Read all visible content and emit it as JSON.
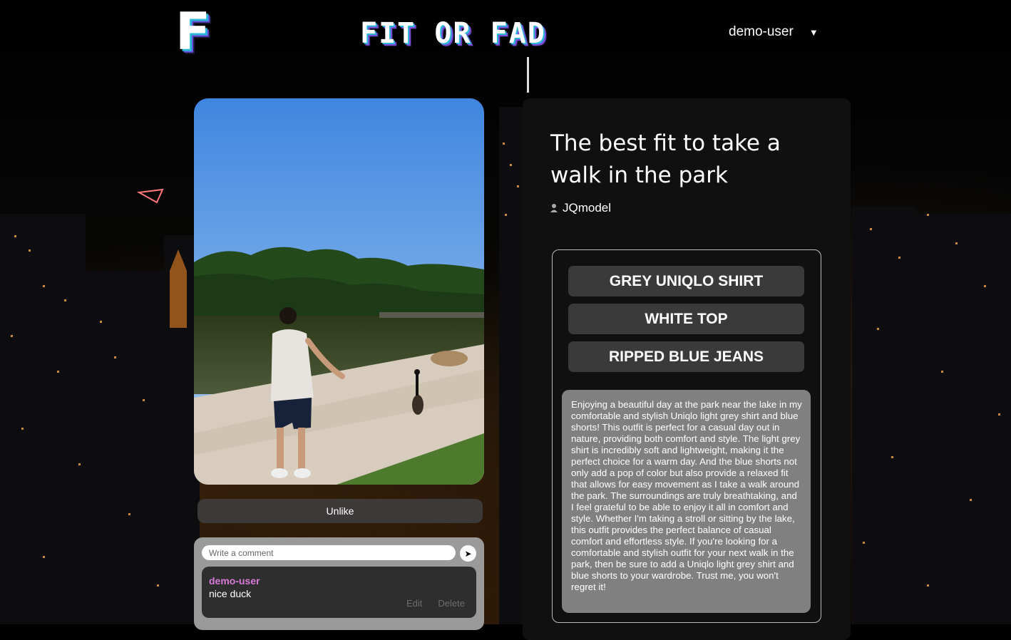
{
  "header": {
    "logo_letter": "F",
    "site_title": "FIT OR FAD",
    "username": "demo-user",
    "dropdown_icon": "caret-down-icon"
  },
  "post": {
    "title": "The best fit to take a walk in the park",
    "author": "JQmodel",
    "author_icon": "user-icon",
    "photo_alt": "Person in grey shirt and blue shorts walking toward a goose by a lake",
    "like_button_label": "Unlike",
    "items": [
      {
        "label": "GREY UNIQLO SHIRT"
      },
      {
        "label": "WHITE TOP"
      },
      {
        "label": "RIPPED BLUE JEANS"
      }
    ],
    "description": "Enjoying a beautiful day at the park near the lake in my comfortable and stylish Uniqlo light grey shirt and blue shorts! This outfit is perfect for a casual day out in nature, providing both comfort and style. The light grey shirt is incredibly soft and lightweight, making it the perfect choice for a warm day. And the blue shorts not only add a pop of color but also provide a relaxed fit that allows for easy movement as I take a walk around the park. The surroundings are truly breathtaking, and I feel grateful to be able to enjoy it all in comfort and style. Whether I'm taking a stroll or sitting by the lake, this outfit provides the perfect balance of casual comfort and effortless style. If you're looking for a comfortable and stylish outfit for your next walk in the park, then be sure to add a Uniqlo light grey shirt and blue shorts to your wardrobe. Trust me, you won't regret it!"
  },
  "comments": {
    "input_placeholder": "Write a comment",
    "send_icon": "send-arrow-icon",
    "list": [
      {
        "author": "demo-user",
        "text": "nice duck",
        "edit_label": "Edit",
        "delete_label": "Delete"
      }
    ]
  },
  "colors": {
    "accent_cyan": "#2bb7d6",
    "accent_purple": "#7a4ad8",
    "comment_author": "#d87ad8",
    "panel_bg": "#101010",
    "button_bg": "#3a3a3a"
  }
}
